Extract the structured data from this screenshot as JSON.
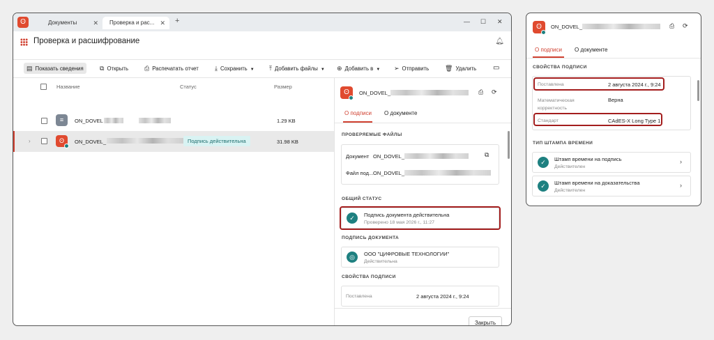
{
  "window": {
    "tabs": [
      {
        "label": "Документы"
      },
      {
        "label": "Проверка и рас..."
      }
    ],
    "tab_close": "✕",
    "tab_add": "+",
    "controls": {
      "minimize": "—",
      "maximize": "☐",
      "close": "✕"
    }
  },
  "header": {
    "title": "Проверка и расшифрование"
  },
  "toolbar": {
    "show_info": "Показать сведения",
    "open": "Открыть",
    "print_report": "Распечатать отчет",
    "save": "Сохранить",
    "add_files": "Добавить файлы",
    "add_to": "Добавить в",
    "send": "Отправить",
    "delete": "Удалить"
  },
  "list": {
    "columns": {
      "name": "Название",
      "status": "Статус",
      "size": "Размер"
    },
    "rows": [
      {
        "name": "ON_DOVEL",
        "status": "",
        "size": "1.29 KB"
      },
      {
        "name": "ON_DOVEL_",
        "status": "Подпись действительна",
        "size": "31.98 KB"
      }
    ]
  },
  "panel": {
    "file_name": "ON_DOVEL_",
    "tabs": {
      "signature": "О подписи",
      "document": "О документе"
    },
    "checked_files_label": "ПРОВЕРЯЕМЫЕ ФАЙЛЫ",
    "document_label": "Документ",
    "document_value": "ON_DOVEL_",
    "signature_file_label": "Файл под...",
    "signature_file_value": "ON_DOVEL_",
    "overall_status_label": "ОБЩИЙ СТАТУС",
    "status_text": "Подпись документа действительна",
    "status_checked": "Проверено 18 мая 2026 г., 11:27",
    "doc_signature_label": "ПОДПИСЬ ДОКУМЕНТА",
    "org_name": "ООО \"ЦИФРОВЫЕ ТЕХНОЛОГИИ\"",
    "org_status": "Действительна",
    "props_label": "СВОЙСТВА ПОДПИСИ",
    "placed_label": "Поставлена",
    "placed_value": "2 августа 2024 г., 9:24",
    "close": "Закрыть"
  },
  "side": {
    "file_name": "ON_DOVEL_",
    "tabs": {
      "signature": "О подписи",
      "document": "О документе"
    },
    "props_label": "СВОЙСТВА ПОДПИСИ",
    "placed_label": "Поставлена",
    "placed_value": "2 августа 2024 г., 9:24",
    "math_label": "Математическая корректность",
    "math_value": "Верна",
    "standard_label": "Стандарт",
    "standard_value": "CAdES-X Long Type 1",
    "timestamp_label": "ТИП ШТАМПА ВРЕМЕНИ",
    "ts_items": [
      {
        "title": "Штамп времени на подпись",
        "status": "Действителен"
      },
      {
        "title": "Штамп времени на доказательства",
        "status": "Действителен"
      }
    ]
  },
  "icons": {
    "app": "app-logo-icon",
    "apps_grid": "apps-grid-icon",
    "bell": "bell-icon",
    "print": "printer-icon",
    "refresh": "refresh-icon",
    "check": "check-icon",
    "chevron": "chevron-right-icon"
  },
  "colors": {
    "accent": "#d04030",
    "success": "#1e8080",
    "highlight": "#a31d1d",
    "badge_bg": "#d9f3f3"
  }
}
